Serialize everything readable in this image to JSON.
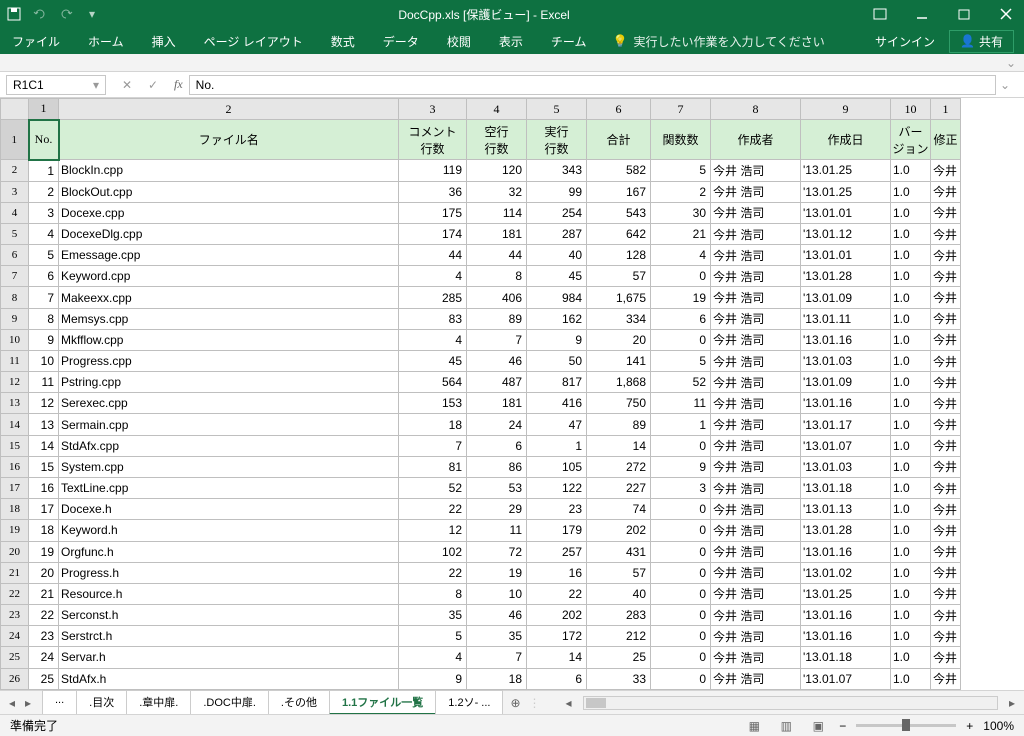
{
  "titlebar": {
    "filename": "DocCpp.xls  [保護ビュー] - Excel"
  },
  "ribbon": {
    "tabs": [
      "ファイル",
      "ホーム",
      "挿入",
      "ページ レイアウト",
      "数式",
      "データ",
      "校閲",
      "表示",
      "チーム"
    ],
    "tell_me": "実行したい作業を入力してください",
    "signin": "サインイン",
    "share": "共有"
  },
  "formula_bar": {
    "name_box": "R1C1",
    "value": "No."
  },
  "col_numbers": [
    "1",
    "2",
    "3",
    "4",
    "5",
    "6",
    "7",
    "8",
    "9",
    "10",
    "1"
  ],
  "headers": [
    "No.",
    "ファイル名",
    "コメント\n行数",
    "空行\n行数",
    "実行\n行数",
    "合計",
    "関数数",
    "作成者",
    "作成日",
    "バー\nジョン",
    "修正"
  ],
  "rows": [
    {
      "r": "2",
      "no": "1",
      "file": "BlockIn.cpp",
      "c": "119",
      "b": "120",
      "e": "343",
      "t": "582",
      "f": "5",
      "a": "今井 浩司",
      "d": "'13.01.25",
      "v": "1.0",
      "m": "今井"
    },
    {
      "r": "3",
      "no": "2",
      "file": "BlockOut.cpp",
      "c": "36",
      "b": "32",
      "e": "99",
      "t": "167",
      "f": "2",
      "a": "今井 浩司",
      "d": "'13.01.25",
      "v": "1.0",
      "m": "今井"
    },
    {
      "r": "4",
      "no": "3",
      "file": "Docexe.cpp",
      "c": "175",
      "b": "114",
      "e": "254",
      "t": "543",
      "f": "30",
      "a": "今井 浩司",
      "d": "'13.01.01",
      "v": "1.0",
      "m": "今井"
    },
    {
      "r": "5",
      "no": "4",
      "file": "DocexeDlg.cpp",
      "c": "174",
      "b": "181",
      "e": "287",
      "t": "642",
      "f": "21",
      "a": "今井 浩司",
      "d": "'13.01.12",
      "v": "1.0",
      "m": "今井"
    },
    {
      "r": "6",
      "no": "5",
      "file": "Emessage.cpp",
      "c": "44",
      "b": "44",
      "e": "40",
      "t": "128",
      "f": "4",
      "a": "今井 浩司",
      "d": "'13.01.01",
      "v": "1.0",
      "m": "今井"
    },
    {
      "r": "7",
      "no": "6",
      "file": "Keyword.cpp",
      "c": "4",
      "b": "8",
      "e": "45",
      "t": "57",
      "f": "0",
      "a": "今井 浩司",
      "d": "'13.01.28",
      "v": "1.0",
      "m": "今井"
    },
    {
      "r": "8",
      "no": "7",
      "file": "Makeexx.cpp",
      "c": "285",
      "b": "406",
      "e": "984",
      "t": "1,675",
      "f": "19",
      "a": "今井 浩司",
      "d": "'13.01.09",
      "v": "1.0",
      "m": "今井"
    },
    {
      "r": "9",
      "no": "8",
      "file": "Memsys.cpp",
      "c": "83",
      "b": "89",
      "e": "162",
      "t": "334",
      "f": "6",
      "a": "今井 浩司",
      "d": "'13.01.11",
      "v": "1.0",
      "m": "今井"
    },
    {
      "r": "10",
      "no": "9",
      "file": "Mkfflow.cpp",
      "c": "4",
      "b": "7",
      "e": "9",
      "t": "20",
      "f": "0",
      "a": "今井 浩司",
      "d": "'13.01.16",
      "v": "1.0",
      "m": "今井"
    },
    {
      "r": "11",
      "no": "10",
      "file": "Progress.cpp",
      "c": "45",
      "b": "46",
      "e": "50",
      "t": "141",
      "f": "5",
      "a": "今井 浩司",
      "d": "'13.01.03",
      "v": "1.0",
      "m": "今井"
    },
    {
      "r": "12",
      "no": "11",
      "file": "Pstring.cpp",
      "c": "564",
      "b": "487",
      "e": "817",
      "t": "1,868",
      "f": "52",
      "a": "今井 浩司",
      "d": "'13.01.09",
      "v": "1.0",
      "m": "今井"
    },
    {
      "r": "13",
      "no": "12",
      "file": "Serexec.cpp",
      "c": "153",
      "b": "181",
      "e": "416",
      "t": "750",
      "f": "11",
      "a": "今井 浩司",
      "d": "'13.01.16",
      "v": "1.0",
      "m": "今井"
    },
    {
      "r": "14",
      "no": "13",
      "file": "Sermain.cpp",
      "c": "18",
      "b": "24",
      "e": "47",
      "t": "89",
      "f": "1",
      "a": "今井 浩司",
      "d": "'13.01.17",
      "v": "1.0",
      "m": "今井"
    },
    {
      "r": "15",
      "no": "14",
      "file": "StdAfx.cpp",
      "c": "7",
      "b": "6",
      "e": "1",
      "t": "14",
      "f": "0",
      "a": "今井 浩司",
      "d": "'13.01.07",
      "v": "1.0",
      "m": "今井"
    },
    {
      "r": "16",
      "no": "15",
      "file": "System.cpp",
      "c": "81",
      "b": "86",
      "e": "105",
      "t": "272",
      "f": "9",
      "a": "今井 浩司",
      "d": "'13.01.03",
      "v": "1.0",
      "m": "今井"
    },
    {
      "r": "17",
      "no": "16",
      "file": "TextLine.cpp",
      "c": "52",
      "b": "53",
      "e": "122",
      "t": "227",
      "f": "3",
      "a": "今井 浩司",
      "d": "'13.01.18",
      "v": "1.0",
      "m": "今井"
    },
    {
      "r": "18",
      "no": "17",
      "file": "Docexe.h",
      "c": "22",
      "b": "29",
      "e": "23",
      "t": "74",
      "f": "0",
      "a": "今井 浩司",
      "d": "'13.01.13",
      "v": "1.0",
      "m": "今井"
    },
    {
      "r": "19",
      "no": "18",
      "file": "Keyword.h",
      "c": "12",
      "b": "11",
      "e": "179",
      "t": "202",
      "f": "0",
      "a": "今井 浩司",
      "d": "'13.01.28",
      "v": "1.0",
      "m": "今井"
    },
    {
      "r": "20",
      "no": "19",
      "file": "Orgfunc.h",
      "c": "102",
      "b": "72",
      "e": "257",
      "t": "431",
      "f": "0",
      "a": "今井 浩司",
      "d": "'13.01.16",
      "v": "1.0",
      "m": "今井"
    },
    {
      "r": "21",
      "no": "20",
      "file": "Progress.h",
      "c": "22",
      "b": "19",
      "e": "16",
      "t": "57",
      "f": "0",
      "a": "今井 浩司",
      "d": "'13.01.02",
      "v": "1.0",
      "m": "今井"
    },
    {
      "r": "22",
      "no": "21",
      "file": "Resource.h",
      "c": "8",
      "b": "10",
      "e": "22",
      "t": "40",
      "f": "0",
      "a": "今井 浩司",
      "d": "'13.01.25",
      "v": "1.0",
      "m": "今井"
    },
    {
      "r": "23",
      "no": "22",
      "file": "Serconst.h",
      "c": "35",
      "b": "46",
      "e": "202",
      "t": "283",
      "f": "0",
      "a": "今井 浩司",
      "d": "'13.01.16",
      "v": "1.0",
      "m": "今井"
    },
    {
      "r": "24",
      "no": "23",
      "file": "Serstrct.h",
      "c": "5",
      "b": "35",
      "e": "172",
      "t": "212",
      "f": "0",
      "a": "今井 浩司",
      "d": "'13.01.16",
      "v": "1.0",
      "m": "今井"
    },
    {
      "r": "25",
      "no": "24",
      "file": "Servar.h",
      "c": "4",
      "b": "7",
      "e": "14",
      "t": "25",
      "f": "0",
      "a": "今井 浩司",
      "d": "'13.01.18",
      "v": "1.0",
      "m": "今井"
    },
    {
      "r": "26",
      "no": "25",
      "file": "StdAfx.h",
      "c": "9",
      "b": "18",
      "e": "6",
      "t": "33",
      "f": "0",
      "a": "今井 浩司",
      "d": "'13.01.07",
      "v": "1.0",
      "m": "今井"
    }
  ],
  "sheet_tabs": {
    "items": [
      "...",
      ".目次",
      ".章中扉.",
      ".DOC中扉.",
      ".その他",
      "1.1ファイル一覧",
      "1.2ソ-  ..."
    ],
    "active": 5
  },
  "status": {
    "ready": "準備完了",
    "zoom": "100%"
  }
}
